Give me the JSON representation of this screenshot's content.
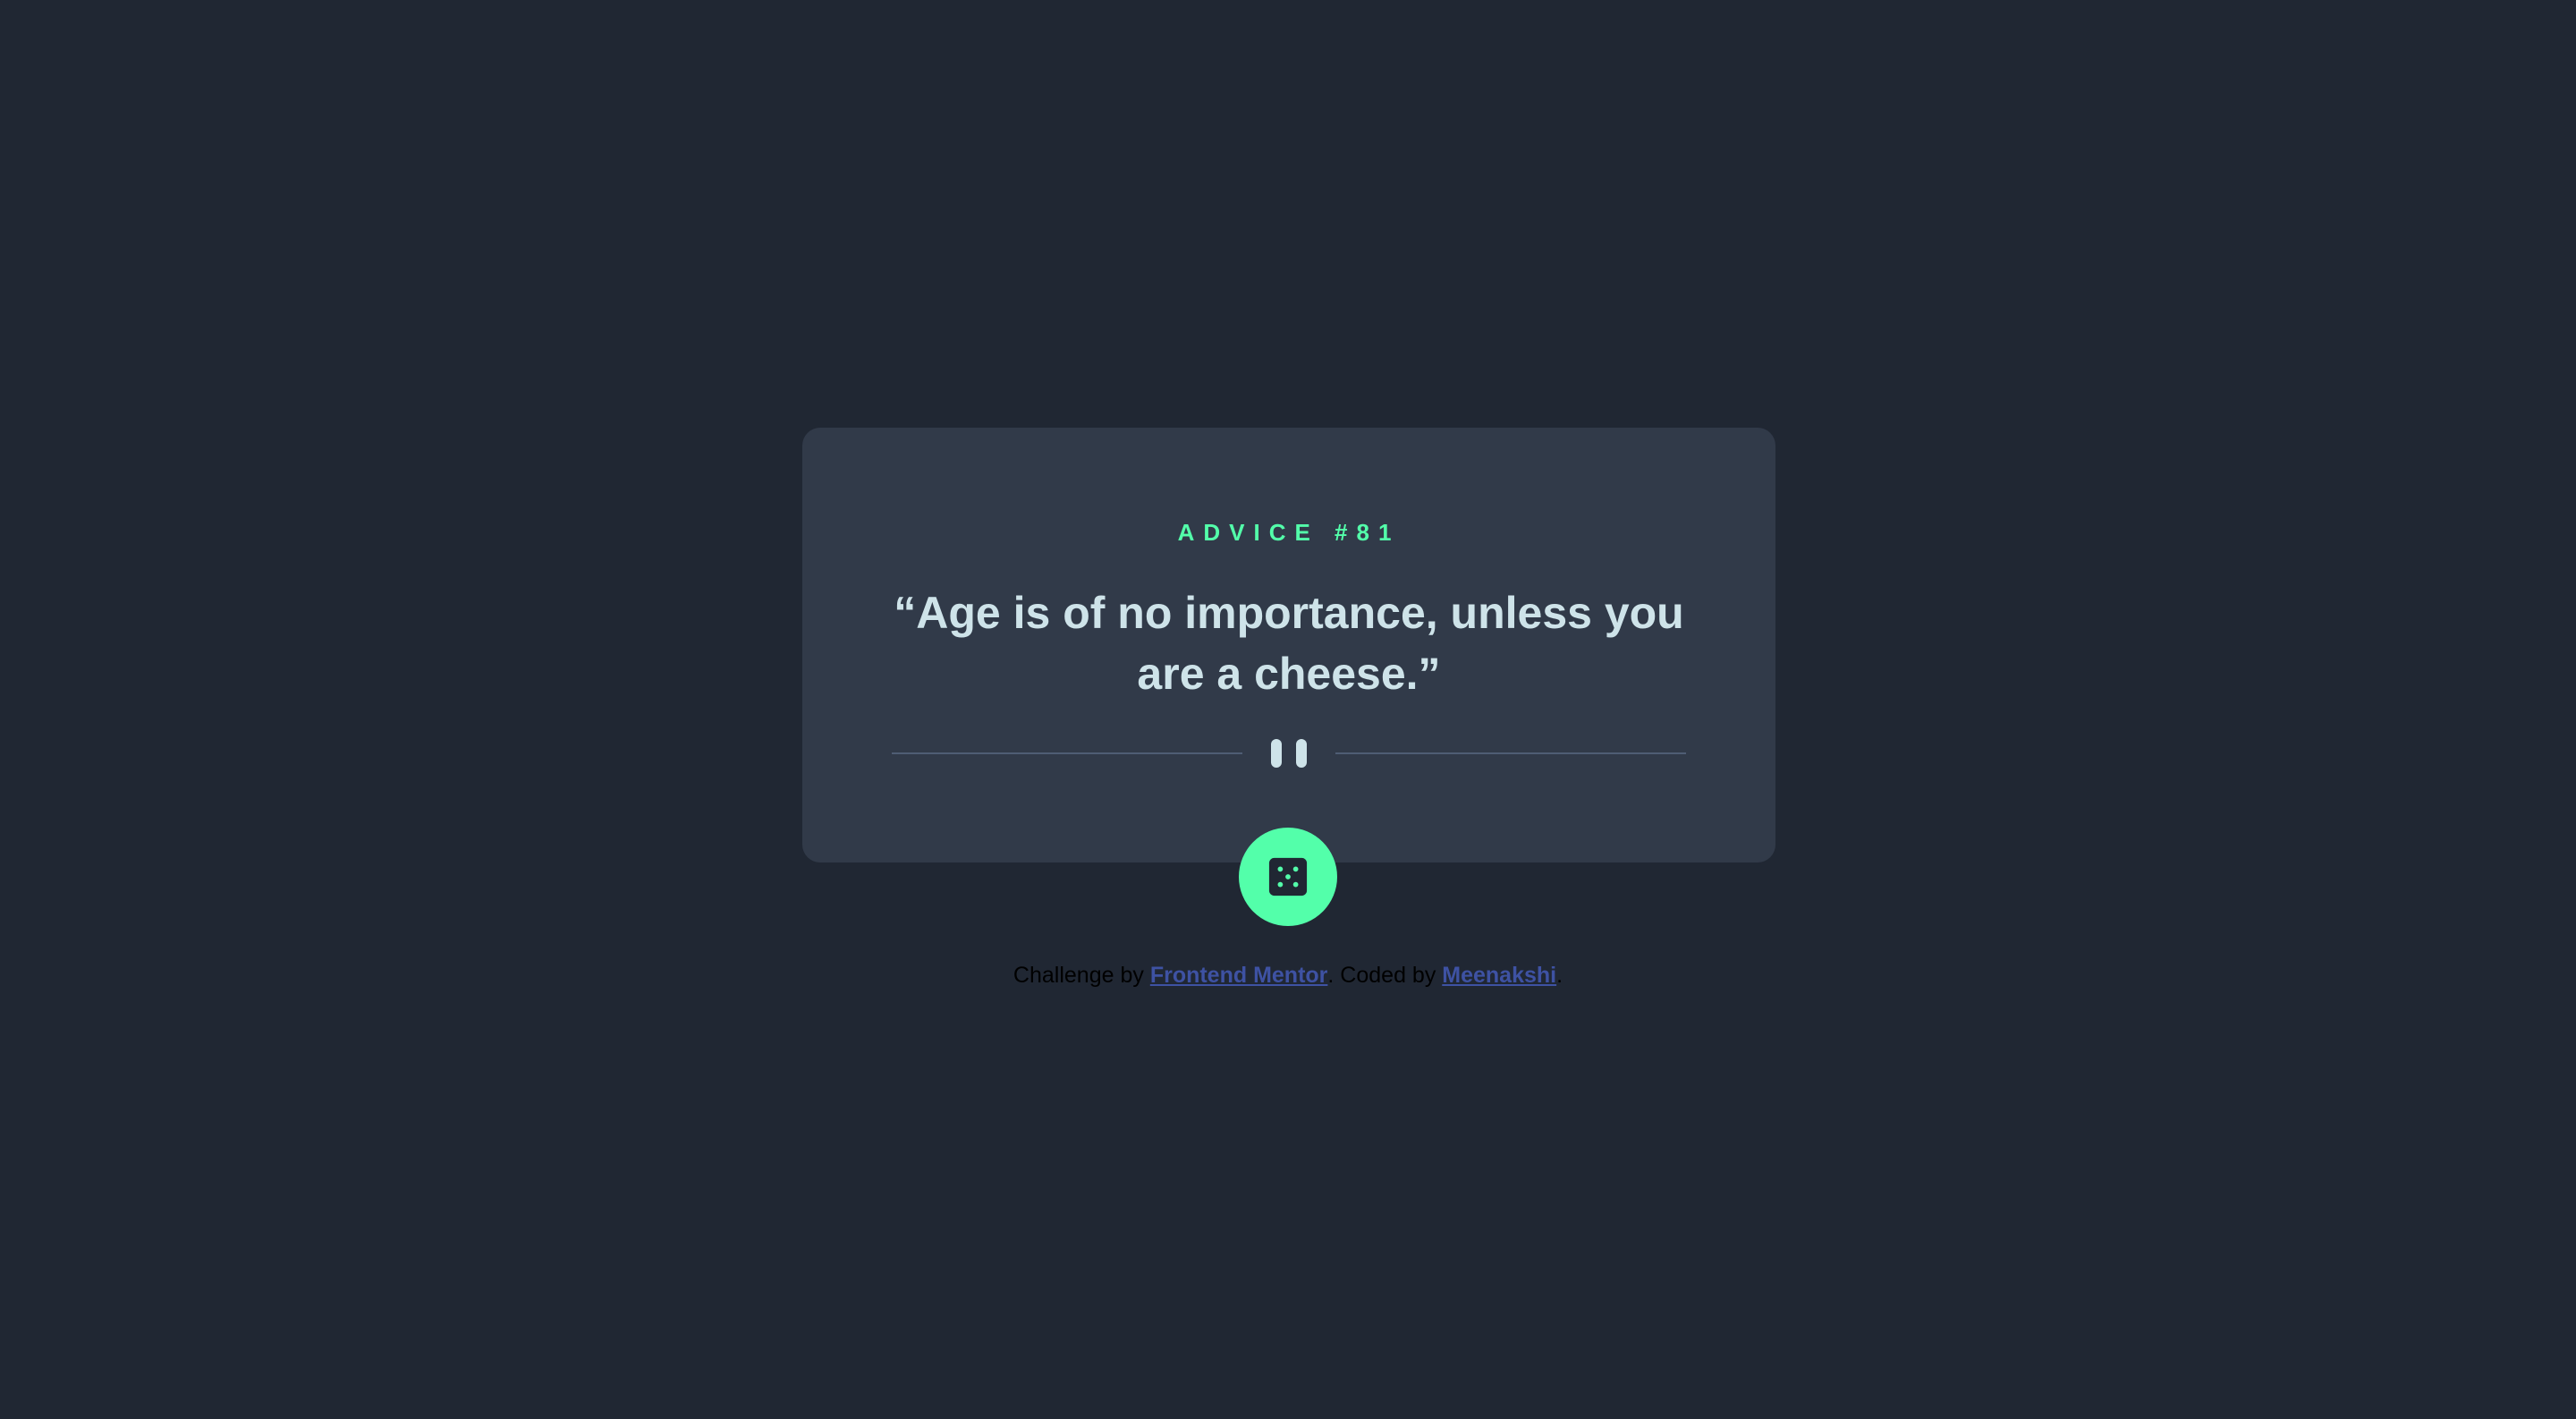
{
  "card": {
    "advice_id": "ADVICE #81",
    "quote": "“Age is of no importance, unless you are a cheese.”"
  },
  "icons": {
    "divider": "pause-icon",
    "generate": "dice-icon"
  },
  "attribution": {
    "challenge_prefix": "Challenge by ",
    "challenge_link": "Frontend Mentor",
    "coded_prefix": ". Coded by ",
    "coder_link": "Meenakshi",
    "suffix": "."
  },
  "colors": {
    "background": "#202733",
    "card": "#313A49",
    "accent": "#53FFAA",
    "quote_text": "#CEE3E9",
    "link": "#3E52A3"
  }
}
